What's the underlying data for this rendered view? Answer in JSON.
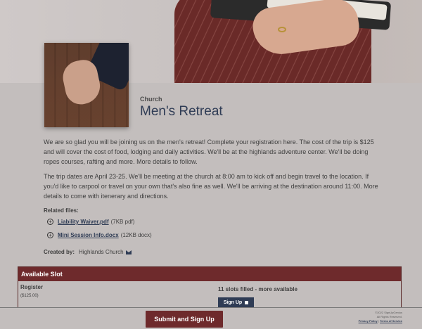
{
  "event": {
    "category": "Church",
    "title": "Men's Retreat",
    "description_1": "We are so glad you will be joining us on the men's retreat! Complete your registration here. The cost of the trip is $125 and will cover the cost of food, lodging and daily activities. We'll be at the highlands adventure center. We'll be doing ropes courses, rafting and more. More details to follow.",
    "description_2": "The trip dates are April 23-25. We'll be meeting at the church at 8:00 am to kick off and begin travel to the location. If you'd like to carpool or travel on your own that's also fine as well. We'll be arriving at the destination around 11:00. More details to come with itenerary and directions."
  },
  "related": {
    "label": "Related files:",
    "files": [
      {
        "name": "Liability Waiver.pdf",
        "meta": "(7KB pdf)"
      },
      {
        "name": "Mini Session Info.docx",
        "meta": "(12KB docx)"
      }
    ]
  },
  "creator": {
    "label": "Created by:",
    "name": "Highlands Church"
  },
  "slots": {
    "header": "Available Slot",
    "rows": [
      {
        "name": "Register",
        "price": "($125.00)",
        "status": "11 slots filled - more available",
        "button": "Sign Up"
      }
    ]
  },
  "footer": {
    "submit": "Submit and Sign Up",
    "copyright": "©2022 SignUpGenius",
    "rights": "All Rights Reserved.",
    "privacy": "Privacy Policy",
    "separator": "|",
    "terms": "Terms of Service"
  },
  "colors": {
    "accent": "#6e2a2c",
    "navy": "#2f3c55",
    "background": "#c3bebd"
  }
}
